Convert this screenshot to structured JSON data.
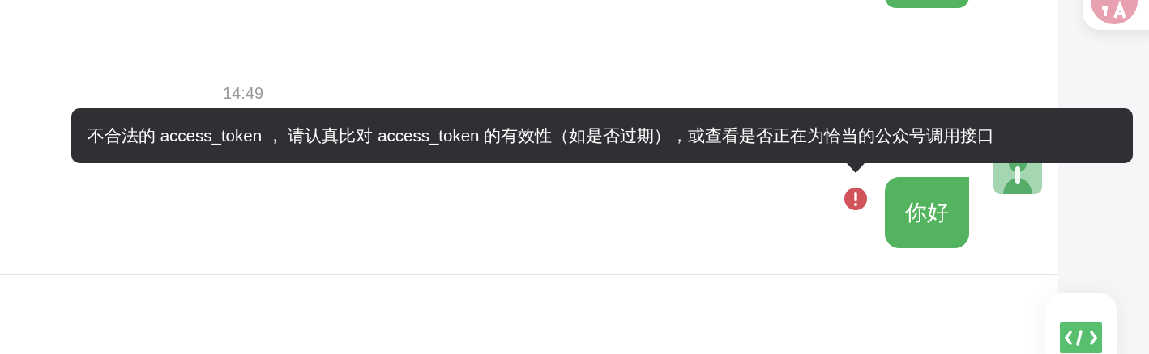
{
  "messages": [
    {
      "kind": "clipped"
    },
    {
      "kind": "time",
      "text": "14:49"
    },
    {
      "kind": "sent",
      "text": "你好",
      "failed": true
    }
  ],
  "tooltip": {
    "text": "不合法的 access_token ， 请认真比对 access_token 的有效性（如是否过期），或查看是否正在为恰当的公众号调用接口"
  }
}
